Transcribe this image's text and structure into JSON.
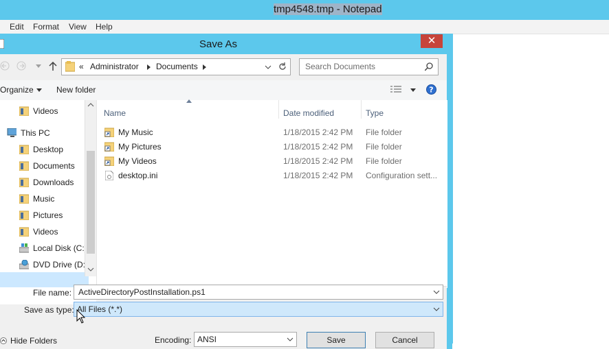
{
  "notepad": {
    "title": "tmp4548.tmp - Notepad",
    "menu": [
      "Edit",
      "Format",
      "View",
      "Help"
    ]
  },
  "dialog": {
    "title": "Save As",
    "close_glyph": "✕",
    "address": {
      "prefix": "«",
      "crumbs": [
        "Administrator",
        "Documents"
      ]
    },
    "search_placeholder": "Search Documents",
    "toolbar": {
      "organize": "Organize",
      "new_folder": "New folder"
    },
    "nav": {
      "items": [
        {
          "label": "Videos",
          "icon": "folder-icon"
        },
        {
          "label": "This PC",
          "icon": "computer-icon"
        },
        {
          "label": "Desktop",
          "icon": "folder-icon"
        },
        {
          "label": "Documents",
          "icon": "folder-icon"
        },
        {
          "label": "Downloads",
          "icon": "folder-icon"
        },
        {
          "label": "Music",
          "icon": "folder-icon"
        },
        {
          "label": "Pictures",
          "icon": "folder-icon"
        },
        {
          "label": "Videos",
          "icon": "folder-icon"
        },
        {
          "label": "Local Disk (C:)",
          "icon": "drive-icon"
        },
        {
          "label": "DVD Drive (D:)",
          "icon": "dvd-icon"
        }
      ]
    },
    "columns": [
      "Name",
      "Date modified",
      "Type"
    ],
    "files": [
      {
        "name": "My Music",
        "date": "1/18/2015 2:42 PM",
        "type": "File folder",
        "icon": "folder-shortcut-icon"
      },
      {
        "name": "My Pictures",
        "date": "1/18/2015 2:42 PM",
        "type": "File folder",
        "icon": "folder-shortcut-icon"
      },
      {
        "name": "My Videos",
        "date": "1/18/2015 2:42 PM",
        "type": "File folder",
        "icon": "folder-shortcut-icon"
      },
      {
        "name": "desktop.ini",
        "date": "1/18/2015 2:42 PM",
        "type": "Configuration sett...",
        "icon": "settings-file-icon"
      }
    ],
    "form": {
      "file_name_label": "File name:",
      "file_name_value": "ActiveDirectoryPostInstallation.ps1",
      "save_type_label": "Save as type:",
      "save_type_value": "All Files  (*.*)",
      "hide_folders": "Hide Folders",
      "encoding_label": "Encoding:",
      "encoding_value": "ANSI",
      "save_label": "Save",
      "cancel_label": "Cancel"
    }
  },
  "colors": {
    "title_bar": "#5cc8ec",
    "close": "#c7443a",
    "selection": "#cce8ff"
  }
}
